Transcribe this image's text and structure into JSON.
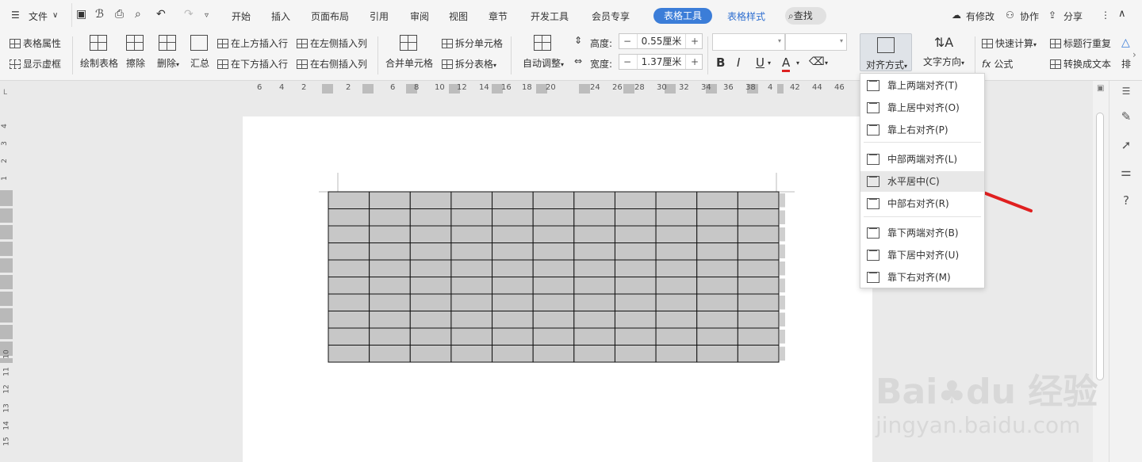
{
  "menubar": {
    "file_menu": "文件",
    "tabs": [
      "开始",
      "插入",
      "页面布局",
      "引用",
      "审阅",
      "视图",
      "章节",
      "开发工具",
      "会员专享"
    ],
    "active_tab": "表格工具",
    "tab_table_style": "表格样式",
    "search": "查找",
    "changes": "有修改",
    "collaborate": "协作",
    "share": "分享"
  },
  "ribbon": {
    "table_props": "表格属性",
    "show_grid": "显示虚框",
    "draw_table": "绘制表格",
    "erase": "擦除",
    "delete": "删除",
    "summary": "汇总",
    "insert_row_above": "在上方插入行",
    "insert_row_below": "在下方插入行",
    "insert_col_left": "在左侧插入列",
    "insert_col_right": "在右侧插入列",
    "merge_cells": "合并单元格",
    "split_cells": "拆分单元格",
    "split_table": "拆分表格",
    "autofit": "自动调整",
    "height_label": "高度:",
    "height_value": "0.55厘米",
    "width_label": "宽度:",
    "width_value": "1.37厘米",
    "alignment": "对齐方式",
    "text_direction": "文字方向",
    "quick_calc": "快速计算",
    "formula": "公式",
    "repeat_header": "标题行重复",
    "convert_text": "转换成文本",
    "sort_cut": "排"
  },
  "hruler_numbers": [
    "6",
    "4",
    "2",
    "2",
    "6",
    "8",
    "10",
    "12",
    "14",
    "16",
    "18",
    "20",
    "24",
    "26",
    "28",
    "30",
    "32",
    "34",
    "36",
    "38",
    "4",
    "42",
    "44",
    "46"
  ],
  "vruler_numbers": [
    "4",
    "3",
    "2",
    "1",
    "10",
    "11",
    "12",
    "13",
    "14",
    "15"
  ],
  "table": {
    "rows": 10,
    "cols": 11,
    "cell_color": "#c7c7c7"
  },
  "align_menu": {
    "items": [
      {
        "label": "靠上两端对齐(T)"
      },
      {
        "label": "靠上居中对齐(O)"
      },
      {
        "label": "靠上右对齐(P)"
      },
      {
        "label": "中部两端对齐(L)"
      },
      {
        "label": "水平居中(C)"
      },
      {
        "label": "中部右对齐(R)"
      },
      {
        "label": "靠下两端对齐(B)"
      },
      {
        "label": "靠下居中对齐(U)"
      },
      {
        "label": "靠下右对齐(M)"
      }
    ],
    "highlighted_index": 4
  },
  "colors": {
    "accent": "#3b7dd8",
    "arrow": "#e02020"
  }
}
